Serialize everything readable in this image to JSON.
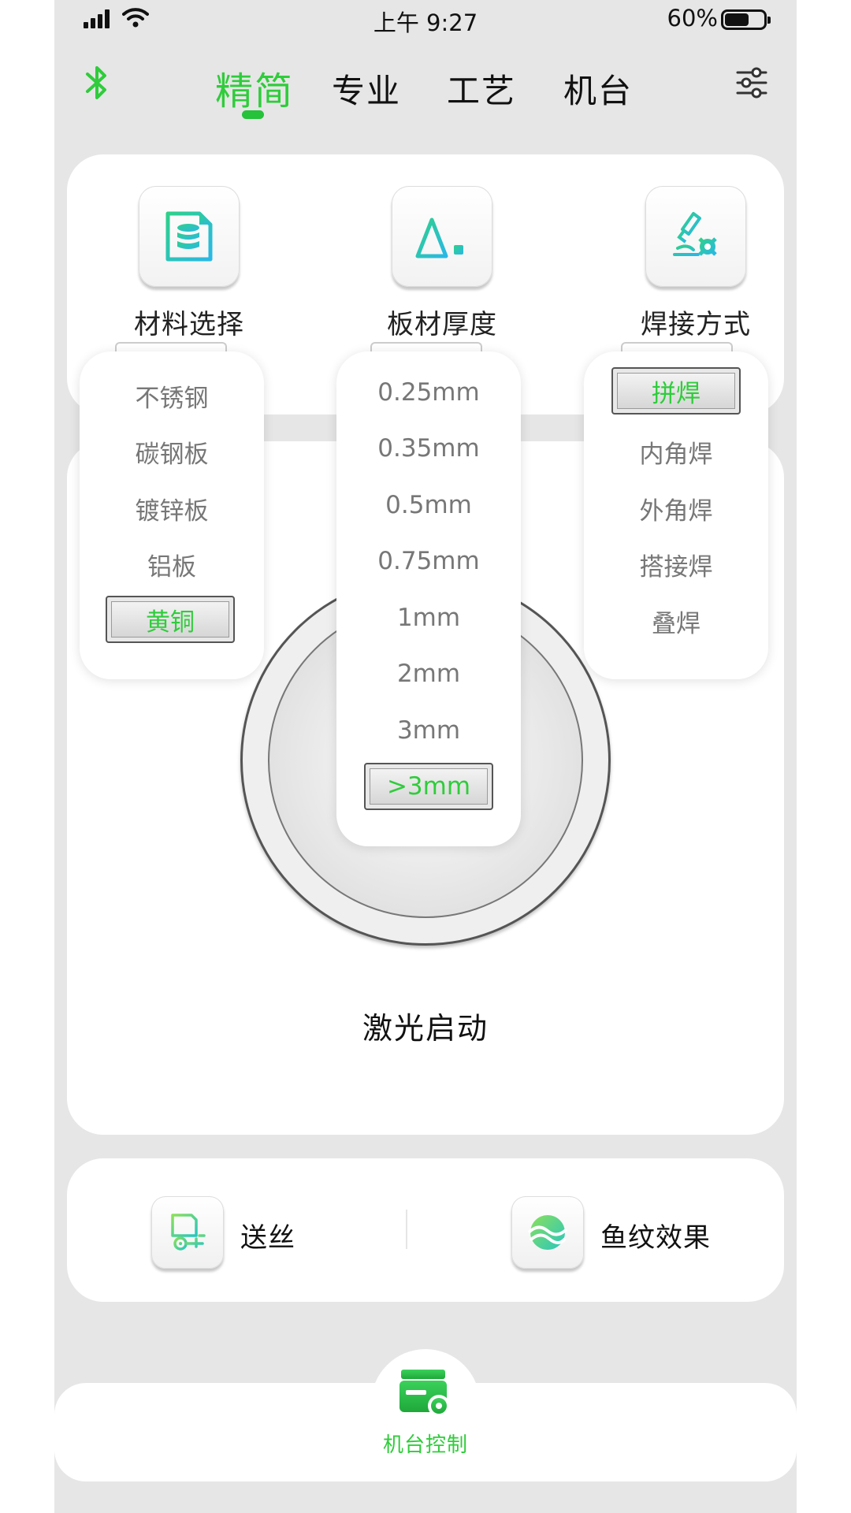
{
  "status_bar": {
    "time": "上午 9:27",
    "battery": "60%"
  },
  "nav": {
    "tabs": [
      {
        "label": "精简",
        "active": true
      },
      {
        "label": "专业",
        "active": false
      },
      {
        "label": "工艺",
        "active": false
      },
      {
        "label": "机台",
        "active": false
      }
    ],
    "left_icon": "bluetooth-icon",
    "right_icon": "settings-sliders-icon"
  },
  "functions": {
    "material": {
      "label": "材料选择",
      "icon": "database-document-icon"
    },
    "thickness": {
      "label": "板材厚度",
      "icon": "triangle-ruler-icon"
    },
    "weld_mode": {
      "label": "焊接方式",
      "icon": "welding-torch-gear-icon"
    }
  },
  "material_options": [
    "不锈钢",
    "碳钢板",
    "镀锌板",
    "铝板",
    "黄铜"
  ],
  "material_selected": "黄铜",
  "thickness_options": [
    "0.25mm",
    "0.35mm",
    "0.5mm",
    "0.75mm",
    "1mm",
    "2mm",
    "3mm",
    ">3mm"
  ],
  "thickness_selected": ">3mm",
  "weld_options": [
    "拼焊",
    "内角焊",
    "外角焊",
    "搭接焊",
    "叠焊"
  ],
  "weld_selected": "拼焊",
  "laser": {
    "label": "激光启动"
  },
  "quick": {
    "wire": {
      "label": "送丝",
      "icon": "wire-feed-icon"
    },
    "fish": {
      "label": "鱼纹效果",
      "icon": "fish-scale-wave-icon"
    }
  },
  "bottom_nav": {
    "label": "机台控制",
    "icon": "machine-control-icon"
  },
  "colors": {
    "accent": "#2fcc3b",
    "background": "#e6e6e6",
    "card": "#ffffff",
    "icon_gradient_start": "#2fd08a",
    "icon_gradient_end": "#29b8e6"
  }
}
